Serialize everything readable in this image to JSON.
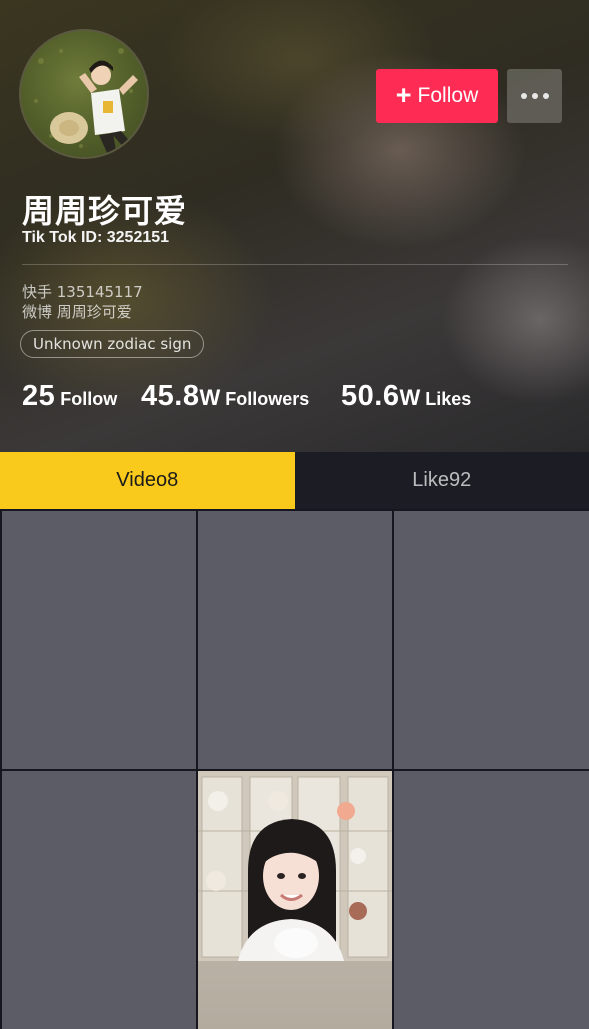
{
  "profile": {
    "name": "周周珍可爱",
    "tiktok_id": "Tik Tok ID: 3252151",
    "bio_lines": [
      "快手 135145117",
      "微博 周周珍可爱"
    ],
    "zodiac": "Unknown zodiac sign"
  },
  "actions": {
    "follow_label": "Follow",
    "follow_icon": "plus-icon",
    "more_icon": "more-dots-icon"
  },
  "stats": [
    {
      "num": "25",
      "unit": "",
      "label": "Follow"
    },
    {
      "num": "45.8",
      "unit": "W",
      "label": "Followers"
    },
    {
      "num": "50.6",
      "unit": "W",
      "label": "Likes"
    }
  ],
  "tabs": [
    {
      "label": "Video8",
      "active": true
    },
    {
      "label": "Like92",
      "active": false
    }
  ],
  "colors": {
    "follow_button": "#fe2c55",
    "active_tab": "#f9ca1b",
    "grid_placeholder": "#5c5c66"
  }
}
